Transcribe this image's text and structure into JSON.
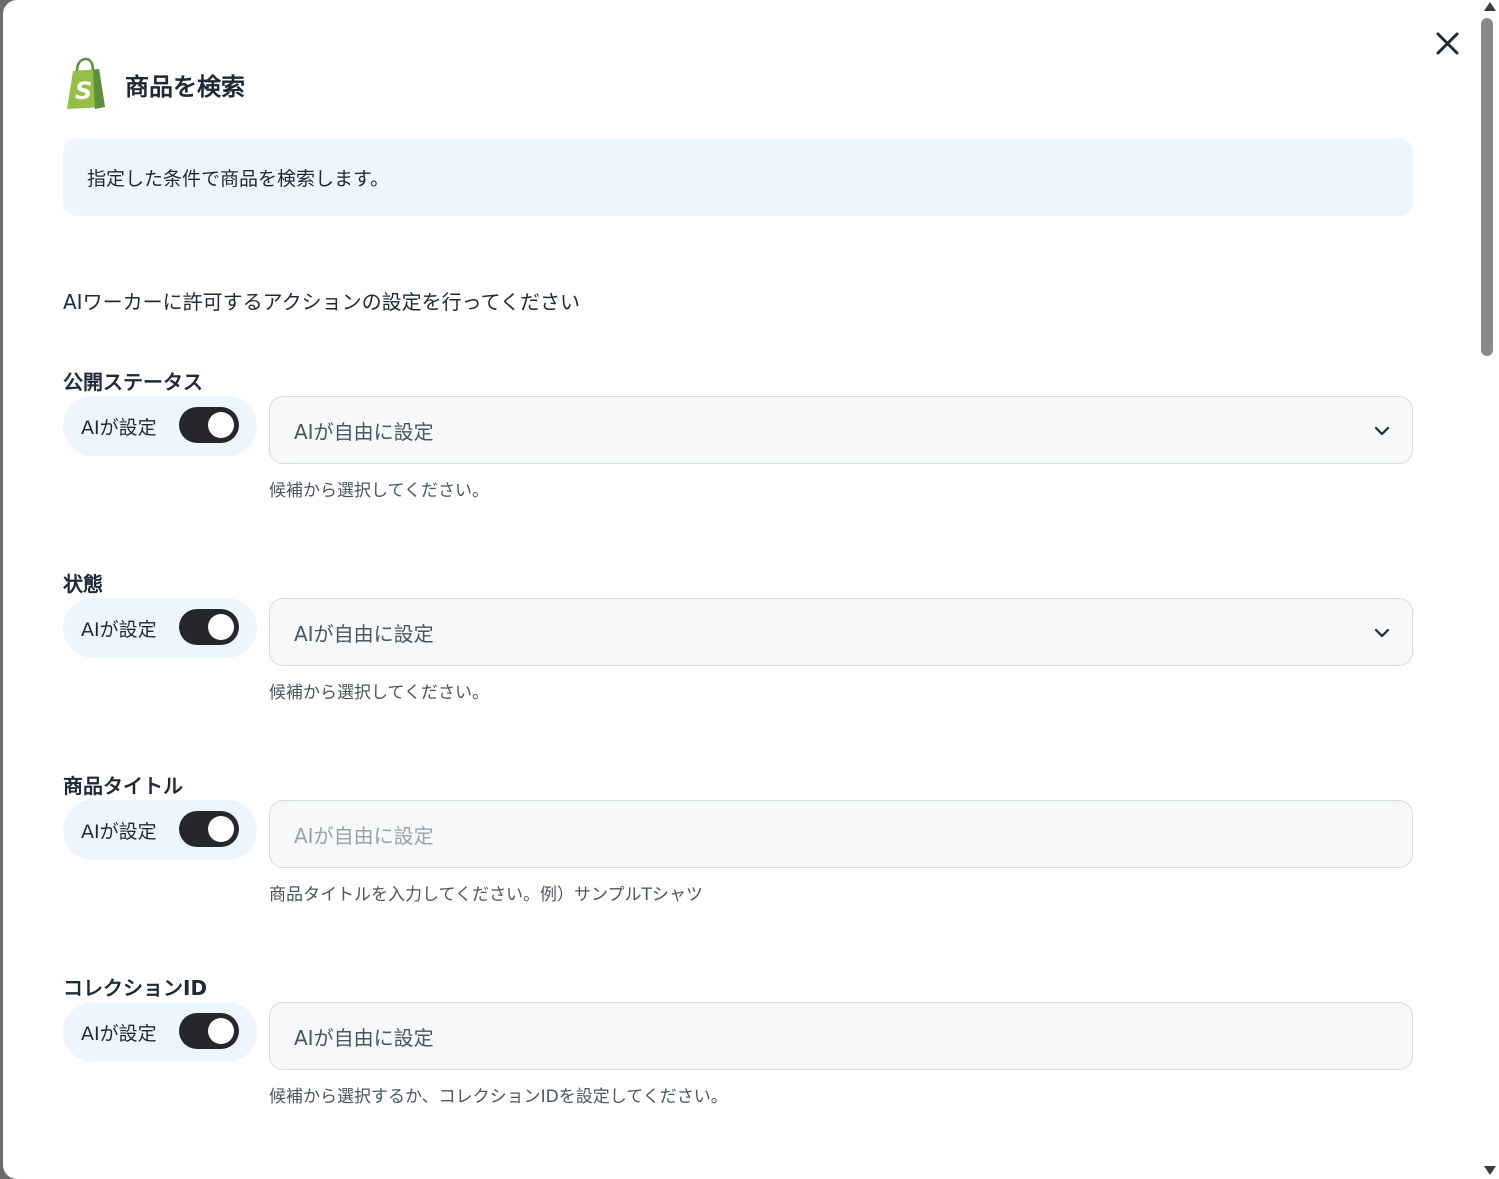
{
  "modal": {
    "title": "商品を検索",
    "description": "指定した条件で商品を検索します。",
    "instruction": "AIワーカーに許可するアクションの設定を行ってください",
    "close_icon": "close-icon",
    "logo_icon": "shopify-bag-icon",
    "brand_color": "#95bf47"
  },
  "fields": [
    {
      "label": "公開ステータス",
      "ai_toggle_label": "AIが設定",
      "ai_toggle_on": true,
      "value": "AIが自由に設定",
      "type": "select",
      "hint": "候補から選択してください。"
    },
    {
      "label": "状態",
      "ai_toggle_label": "AIが設定",
      "ai_toggle_on": true,
      "value": "AIが自由に設定",
      "type": "select",
      "hint": "候補から選択してください。"
    },
    {
      "label": "商品タイトル",
      "ai_toggle_label": "AIが設定",
      "ai_toggle_on": true,
      "placeholder": "AIが自由に設定",
      "type": "text",
      "hint": "商品タイトルを入力してください。例）サンプルTシャツ"
    },
    {
      "label": "コレクションID",
      "ai_toggle_label": "AIが設定",
      "ai_toggle_on": true,
      "value": "AIが自由に設定",
      "type": "text",
      "hint": "候補から選択するか、コレクションIDを設定してください。"
    }
  ],
  "colors": {
    "toggle_on": "#26272b",
    "info_background": "#edf6fe",
    "input_background": "#f6f8fa"
  }
}
